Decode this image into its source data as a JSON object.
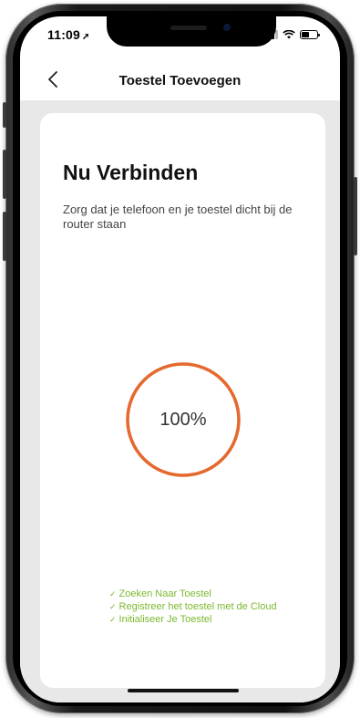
{
  "status_bar": {
    "time": "11:09",
    "location_arrow": "location-arrow-icon",
    "signal_bars": 3,
    "battery_fraction": 0.5
  },
  "nav": {
    "back_icon": "chevron-left-icon",
    "title": "Toestel Toevoegen"
  },
  "card": {
    "title": "Nu Verbinden",
    "subtitle": "Zorg dat je telefoon en je toestel dicht bij de router staan",
    "progress_percent": 100,
    "progress_label": "100%",
    "steps": [
      {
        "label": "Zoeken Naar Toestel",
        "icon": "check-icon",
        "done": true
      },
      {
        "label": "Registreer het toestel met de Cloud",
        "icon": "check-icon",
        "done": true
      },
      {
        "label": "Initialiseer Je Toestel",
        "icon": "check-icon",
        "done": true
      }
    ]
  },
  "colors": {
    "progress_ring": "#e5692e",
    "step_done": "#7cb82f",
    "content_background": "#e8e8e8"
  }
}
